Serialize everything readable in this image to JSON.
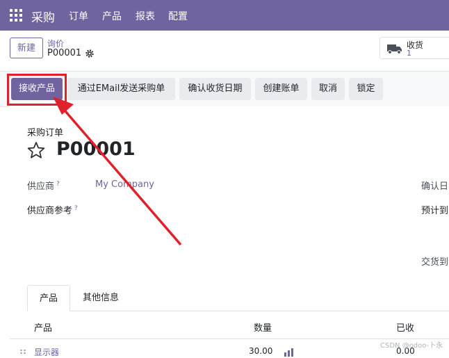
{
  "topbar": {
    "app_name": "采购",
    "menu": [
      "订单",
      "产品",
      "报表",
      "配置"
    ]
  },
  "control_panel": {
    "new_button": "新建",
    "breadcrumb_parent": "询价",
    "breadcrumb_current": "P00001",
    "receipt_label": "收货",
    "receipt_count": "1"
  },
  "actions": {
    "receive": "接收产品",
    "send_email": "通过EMail发送采购单",
    "confirm_date": "确认收货日期",
    "create_bill": "创建账单",
    "cancel": "取消",
    "lock": "锁定"
  },
  "form": {
    "doc_type": "采购订单",
    "title": "P00001",
    "vendor_label": "供应商",
    "vendor_value": "My Company",
    "vendor_ref_label": "供应商参考",
    "help_mark": "?",
    "confirm_date_label": "确认日",
    "expected_label": "预计到",
    "deliver_to_label": "交货到"
  },
  "tabs": [
    "产品",
    "其他信息"
  ],
  "table": {
    "headers": [
      "产品",
      "数量",
      "已收"
    ],
    "rows": [
      {
        "product": "显示器",
        "quantity": "30.00",
        "received": "0.00"
      }
    ]
  },
  "watermark": "CSDN @odoo-卜永",
  "colors": {
    "brand": "#71639e",
    "annotation": "#e0202b"
  }
}
